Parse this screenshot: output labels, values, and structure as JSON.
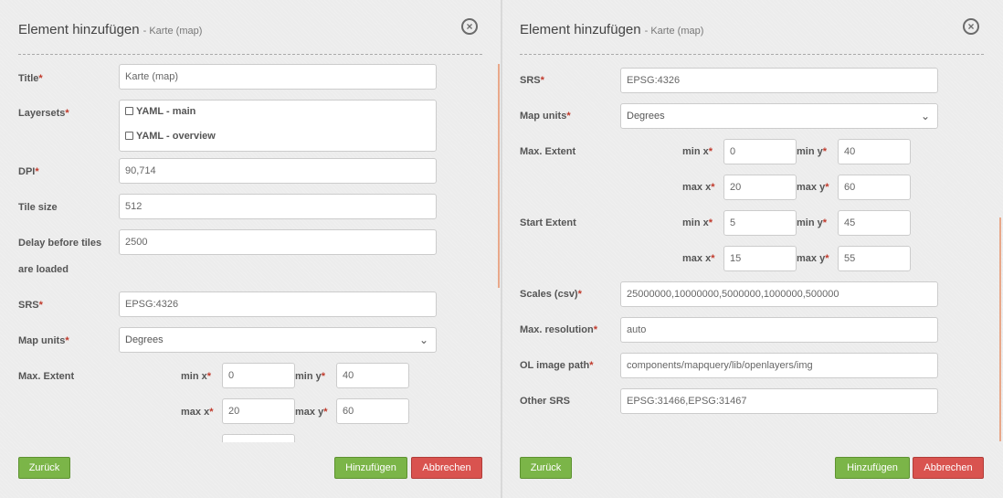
{
  "left": {
    "title": "Element hinzufügen",
    "subtitle": "- Karte (map)",
    "fields": {
      "title_label": "Title",
      "title_value": "Karte (map)",
      "layersets_label": "Layersets",
      "layersets": [
        "YAML - main",
        "YAML - overview"
      ],
      "dpi_label": "DPI",
      "dpi_value": "90,714",
      "tile_label": "Tile size",
      "tile_value": "512",
      "delay_label_1": "Delay before tiles",
      "delay_label_2": "are loaded",
      "delay_value": "2500",
      "srs_label": "SRS",
      "srs_value": "EPSG:4326",
      "units_label": "Map units",
      "units_value": "Degrees",
      "maxext_label": "Max. Extent",
      "minx_label": "min x",
      "minx_value": "0",
      "miny_label": "min y",
      "miny_value": "40",
      "maxx_label": "max x",
      "maxx_value": "20",
      "maxy_label": "max y",
      "maxy_value": "60"
    }
  },
  "right": {
    "title": "Element hinzufügen",
    "subtitle": "- Karte (map)",
    "fields": {
      "srs_label": "SRS",
      "srs_value": "EPSG:4326",
      "units_label": "Map units",
      "units_value": "Degrees",
      "maxext_label": "Max. Extent",
      "maxext_minx": "0",
      "maxext_miny": "40",
      "maxext_maxx": "20",
      "maxext_maxy": "60",
      "startext_label": "Start Extent",
      "startext_minx": "5",
      "startext_miny": "45",
      "startext_maxx": "15",
      "startext_maxy": "55",
      "minx_label": "min x",
      "miny_label": "min y",
      "maxx_label": "max x",
      "maxy_label": "max y",
      "scales_label": "Scales (csv)",
      "scales_value": "25000000,10000000,5000000,1000000,500000",
      "maxres_label": "Max. resolution",
      "maxres_value": "auto",
      "olpath_label": "OL image path",
      "olpath_value": "components/mapquery/lib/openlayers/img",
      "othersrs_label": "Other SRS",
      "othersrs_value": "EPSG:31466,EPSG:31467"
    }
  },
  "buttons": {
    "back": "Zurück",
    "add": "Hinzufügen",
    "cancel": "Abbrechen"
  },
  "icons": {
    "close": "close-circle-icon",
    "dropdown": "chevron-down-icon",
    "checkbox": "checkbox-icon"
  },
  "colors": {
    "button_green": "#7bb548",
    "button_red": "#d9534f",
    "required": "#c0392b"
  }
}
